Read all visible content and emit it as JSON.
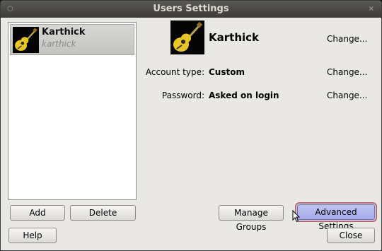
{
  "window": {
    "title": "Users Settings",
    "left_icon": "○",
    "right_icon": "×"
  },
  "users": [
    {
      "name": "Karthick",
      "login": "karthick"
    }
  ],
  "detail": {
    "name": "Karthick",
    "change_label": "Change...",
    "account_type_label": "Account type:",
    "account_type_value": "Custom",
    "password_label": "Password:",
    "password_value": "Asked on login"
  },
  "buttons": {
    "add": "Add",
    "delete": "Delete",
    "manage_groups": "Manage Groups",
    "advanced_settings": "Advanced Settings",
    "help": "Help",
    "close": "Close"
  },
  "icons": {
    "avatar": "guitar-icon",
    "close": "close-icon",
    "menu": "window-menu-icon",
    "cursor": "mouse-pointer-icon"
  },
  "colors": {
    "titlebar": "#3c3b37",
    "window_bg": "#e9e8e5",
    "selected_row": "#c9c8c5",
    "advanced_button": "#a6acec",
    "focus_outline": "#b06b7a"
  }
}
